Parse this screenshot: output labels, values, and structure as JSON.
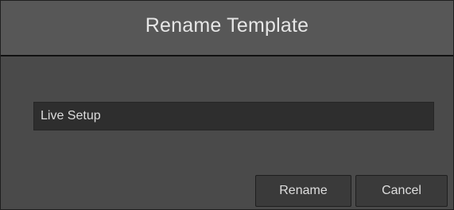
{
  "dialog": {
    "title": "Rename Template"
  },
  "field": {
    "value": "Live Setup"
  },
  "buttons": {
    "rename": "Rename",
    "cancel": "Cancel"
  },
  "colors": {
    "dialog_background": "#4a4a4a",
    "titlebar_background": "#575757",
    "field_background": "#2e2e2e",
    "button_background": "#3a3a3a",
    "text": "#dcdcdc"
  }
}
